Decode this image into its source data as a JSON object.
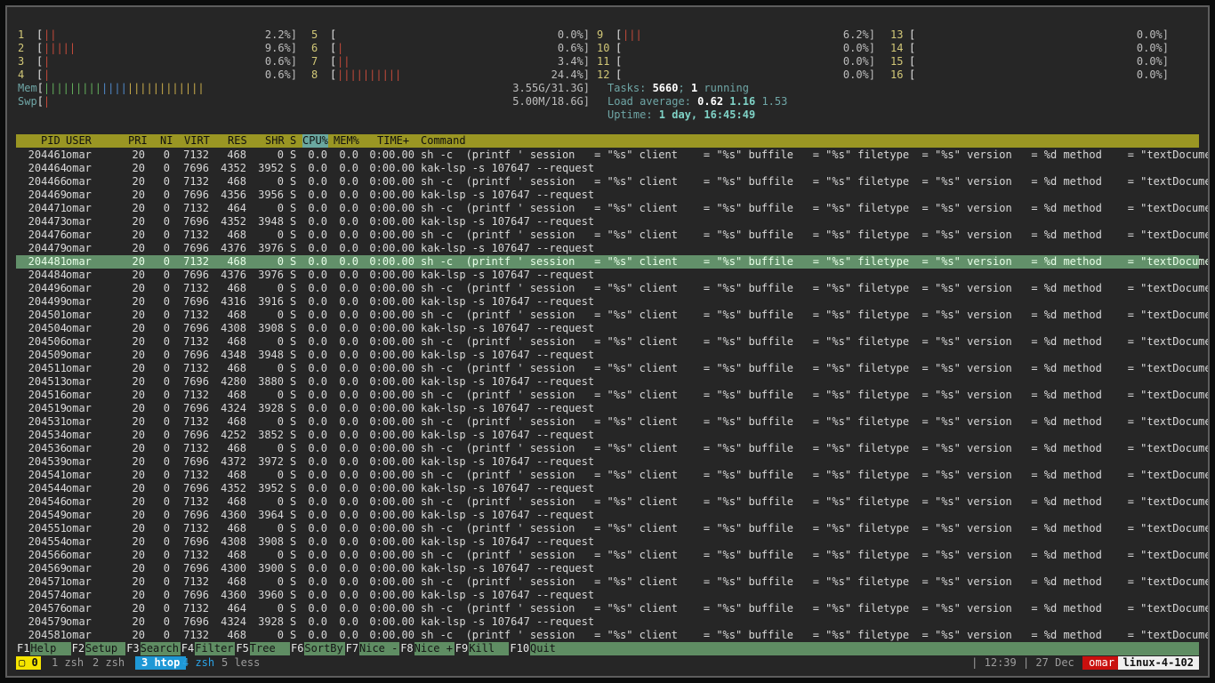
{
  "cpus": [
    {
      "id": "1",
      "pct": "2.2%]",
      "bars": [
        [
          "red",
          "||"
        ]
      ]
    },
    {
      "id": "2",
      "pct": "9.6%]",
      "bars": [
        [
          "red",
          "|||||"
        ]
      ]
    },
    {
      "id": "3",
      "pct": "0.6%]",
      "bars": [
        [
          "red",
          "|"
        ]
      ]
    },
    {
      "id": "4",
      "pct": "0.6%]",
      "bars": [
        [
          "red",
          "|"
        ]
      ]
    },
    {
      "id": "5",
      "pct": "0.0%]",
      "bars": []
    },
    {
      "id": "6",
      "pct": "0.6%]",
      "bars": [
        [
          "red",
          "|"
        ]
      ]
    },
    {
      "id": "7",
      "pct": "3.4%]",
      "bars": [
        [
          "red",
          "||"
        ]
      ]
    },
    {
      "id": "8",
      "pct": "24.4%]",
      "bars": [
        [
          "red",
          "||||||||||"
        ]
      ]
    },
    {
      "id": "9",
      "pct": "6.2%]",
      "bars": [
        [
          "red",
          "|||"
        ]
      ]
    },
    {
      "id": "10",
      "pct": "0.0%]",
      "bars": []
    },
    {
      "id": "11",
      "pct": "0.0%]",
      "bars": []
    },
    {
      "id": "12",
      "pct": "0.0%]",
      "bars": []
    },
    {
      "id": "13",
      "pct": "0.0%]",
      "bars": []
    },
    {
      "id": "14",
      "pct": "0.0%]",
      "bars": []
    },
    {
      "id": "15",
      "pct": "0.0%]",
      "bars": []
    },
    {
      "id": "16",
      "pct": "0.0%]",
      "bars": []
    }
  ],
  "mem": {
    "label": "Mem",
    "value": "3.55G/31.3G]",
    "bars": [
      [
        "grn",
        "|||||||||"
      ],
      [
        "blu",
        "||||"
      ],
      [
        "yel",
        "||||||||||||"
      ]
    ]
  },
  "swp": {
    "label": "Swp",
    "value": "5.00M/18.6G]",
    "bars": [
      [
        "red",
        "|"
      ]
    ]
  },
  "tasks": {
    "label": "Tasks: ",
    "count": "5660",
    "sep": "; ",
    "running": "1",
    "running_label": " running"
  },
  "load": {
    "label": "Load average: ",
    "l1": "0.62",
    "l5": "1.16",
    "l15": "1.53"
  },
  "uptime": {
    "label": "Uptime: ",
    "value": "1 day, 16:45:49"
  },
  "columns": {
    "pid": "PID",
    "user": "USER",
    "pri": "PRI",
    "ni": "NI",
    "virt": "VIRT",
    "res": "RES",
    "shr": "SHR",
    "s": "S",
    "cpu": "CPU%",
    "mem": "MEM%",
    "time": "TIME+",
    "command": "Command"
  },
  "cmd_sh": "sh -c  (printf ' session   = \"%s\" client    = \"%s\" buffile   = \"%s\" filetype  = \"%s\" version   = %d method    = \"textDocument",
  "cmd_kak": "kak-lsp -s 107647 --request",
  "processes": [
    {
      "pid": "204461",
      "user": "omar",
      "pri": "20",
      "ni": "0",
      "virt": "7132",
      "res": "468",
      "shr": "0",
      "s": "S",
      "cpu": "0.0",
      "mem": "0.0",
      "time": "0:00.00",
      "cmd": "sh"
    },
    {
      "pid": "204464",
      "user": "omar",
      "pri": "20",
      "ni": "0",
      "virt": "7696",
      "res": "4352",
      "shr": "3952",
      "s": "S",
      "cpu": "0.0",
      "mem": "0.0",
      "time": "0:00.00",
      "cmd": "kak"
    },
    {
      "pid": "204466",
      "user": "omar",
      "pri": "20",
      "ni": "0",
      "virt": "7132",
      "res": "468",
      "shr": "0",
      "s": "S",
      "cpu": "0.0",
      "mem": "0.0",
      "time": "0:00.00",
      "cmd": "sh"
    },
    {
      "pid": "204469",
      "user": "omar",
      "pri": "20",
      "ni": "0",
      "virt": "7696",
      "res": "4356",
      "shr": "3956",
      "s": "S",
      "cpu": "0.0",
      "mem": "0.0",
      "time": "0:00.00",
      "cmd": "kak"
    },
    {
      "pid": "204471",
      "user": "omar",
      "pri": "20",
      "ni": "0",
      "virt": "7132",
      "res": "464",
      "shr": "0",
      "s": "S",
      "cpu": "0.0",
      "mem": "0.0",
      "time": "0:00.00",
      "cmd": "sh"
    },
    {
      "pid": "204473",
      "user": "omar",
      "pri": "20",
      "ni": "0",
      "virt": "7696",
      "res": "4352",
      "shr": "3948",
      "s": "S",
      "cpu": "0.0",
      "mem": "0.0",
      "time": "0:00.00",
      "cmd": "kak"
    },
    {
      "pid": "204476",
      "user": "omar",
      "pri": "20",
      "ni": "0",
      "virt": "7132",
      "res": "468",
      "shr": "0",
      "s": "S",
      "cpu": "0.0",
      "mem": "0.0",
      "time": "0:00.00",
      "cmd": "sh"
    },
    {
      "pid": "204479",
      "user": "omar",
      "pri": "20",
      "ni": "0",
      "virt": "7696",
      "res": "4376",
      "shr": "3976",
      "s": "S",
      "cpu": "0.0",
      "mem": "0.0",
      "time": "0:00.00",
      "cmd": "kak"
    },
    {
      "pid": "204481",
      "user": "omar",
      "pri": "20",
      "ni": "0",
      "virt": "7132",
      "res": "468",
      "shr": "0",
      "s": "S",
      "cpu": "0.0",
      "mem": "0.0",
      "time": "0:00.00",
      "cmd": "sh",
      "selected": true
    },
    {
      "pid": "204484",
      "user": "omar",
      "pri": "20",
      "ni": "0",
      "virt": "7696",
      "res": "4376",
      "shr": "3976",
      "s": "S",
      "cpu": "0.0",
      "mem": "0.0",
      "time": "0:00.00",
      "cmd": "kak"
    },
    {
      "pid": "204496",
      "user": "omar",
      "pri": "20",
      "ni": "0",
      "virt": "7132",
      "res": "468",
      "shr": "0",
      "s": "S",
      "cpu": "0.0",
      "mem": "0.0",
      "time": "0:00.00",
      "cmd": "sh"
    },
    {
      "pid": "204499",
      "user": "omar",
      "pri": "20",
      "ni": "0",
      "virt": "7696",
      "res": "4316",
      "shr": "3916",
      "s": "S",
      "cpu": "0.0",
      "mem": "0.0",
      "time": "0:00.00",
      "cmd": "kak"
    },
    {
      "pid": "204501",
      "user": "omar",
      "pri": "20",
      "ni": "0",
      "virt": "7132",
      "res": "468",
      "shr": "0",
      "s": "S",
      "cpu": "0.0",
      "mem": "0.0",
      "time": "0:00.00",
      "cmd": "sh"
    },
    {
      "pid": "204504",
      "user": "omar",
      "pri": "20",
      "ni": "0",
      "virt": "7696",
      "res": "4308",
      "shr": "3908",
      "s": "S",
      "cpu": "0.0",
      "mem": "0.0",
      "time": "0:00.00",
      "cmd": "kak"
    },
    {
      "pid": "204506",
      "user": "omar",
      "pri": "20",
      "ni": "0",
      "virt": "7132",
      "res": "468",
      "shr": "0",
      "s": "S",
      "cpu": "0.0",
      "mem": "0.0",
      "time": "0:00.00",
      "cmd": "sh"
    },
    {
      "pid": "204509",
      "user": "omar",
      "pri": "20",
      "ni": "0",
      "virt": "7696",
      "res": "4348",
      "shr": "3948",
      "s": "S",
      "cpu": "0.0",
      "mem": "0.0",
      "time": "0:00.00",
      "cmd": "kak"
    },
    {
      "pid": "204511",
      "user": "omar",
      "pri": "20",
      "ni": "0",
      "virt": "7132",
      "res": "468",
      "shr": "0",
      "s": "S",
      "cpu": "0.0",
      "mem": "0.0",
      "time": "0:00.00",
      "cmd": "sh"
    },
    {
      "pid": "204513",
      "user": "omar",
      "pri": "20",
      "ni": "0",
      "virt": "7696",
      "res": "4280",
      "shr": "3880",
      "s": "S",
      "cpu": "0.0",
      "mem": "0.0",
      "time": "0:00.00",
      "cmd": "kak"
    },
    {
      "pid": "204516",
      "user": "omar",
      "pri": "20",
      "ni": "0",
      "virt": "7132",
      "res": "468",
      "shr": "0",
      "s": "S",
      "cpu": "0.0",
      "mem": "0.0",
      "time": "0:00.00",
      "cmd": "sh"
    },
    {
      "pid": "204519",
      "user": "omar",
      "pri": "20",
      "ni": "0",
      "virt": "7696",
      "res": "4324",
      "shr": "3928",
      "s": "S",
      "cpu": "0.0",
      "mem": "0.0",
      "time": "0:00.00",
      "cmd": "kak"
    },
    {
      "pid": "204531",
      "user": "omar",
      "pri": "20",
      "ni": "0",
      "virt": "7132",
      "res": "468",
      "shr": "0",
      "s": "S",
      "cpu": "0.0",
      "mem": "0.0",
      "time": "0:00.00",
      "cmd": "sh"
    },
    {
      "pid": "204534",
      "user": "omar",
      "pri": "20",
      "ni": "0",
      "virt": "7696",
      "res": "4252",
      "shr": "3852",
      "s": "S",
      "cpu": "0.0",
      "mem": "0.0",
      "time": "0:00.00",
      "cmd": "kak"
    },
    {
      "pid": "204536",
      "user": "omar",
      "pri": "20",
      "ni": "0",
      "virt": "7132",
      "res": "468",
      "shr": "0",
      "s": "S",
      "cpu": "0.0",
      "mem": "0.0",
      "time": "0:00.00",
      "cmd": "sh"
    },
    {
      "pid": "204539",
      "user": "omar",
      "pri": "20",
      "ni": "0",
      "virt": "7696",
      "res": "4372",
      "shr": "3972",
      "s": "S",
      "cpu": "0.0",
      "mem": "0.0",
      "time": "0:00.00",
      "cmd": "kak"
    },
    {
      "pid": "204541",
      "user": "omar",
      "pri": "20",
      "ni": "0",
      "virt": "7132",
      "res": "468",
      "shr": "0",
      "s": "S",
      "cpu": "0.0",
      "mem": "0.0",
      "time": "0:00.00",
      "cmd": "sh"
    },
    {
      "pid": "204544",
      "user": "omar",
      "pri": "20",
      "ni": "0",
      "virt": "7696",
      "res": "4352",
      "shr": "3952",
      "s": "S",
      "cpu": "0.0",
      "mem": "0.0",
      "time": "0:00.00",
      "cmd": "kak"
    },
    {
      "pid": "204546",
      "user": "omar",
      "pri": "20",
      "ni": "0",
      "virt": "7132",
      "res": "468",
      "shr": "0",
      "s": "S",
      "cpu": "0.0",
      "mem": "0.0",
      "time": "0:00.00",
      "cmd": "sh"
    },
    {
      "pid": "204549",
      "user": "omar",
      "pri": "20",
      "ni": "0",
      "virt": "7696",
      "res": "4360",
      "shr": "3964",
      "s": "S",
      "cpu": "0.0",
      "mem": "0.0",
      "time": "0:00.00",
      "cmd": "kak"
    },
    {
      "pid": "204551",
      "user": "omar",
      "pri": "20",
      "ni": "0",
      "virt": "7132",
      "res": "468",
      "shr": "0",
      "s": "S",
      "cpu": "0.0",
      "mem": "0.0",
      "time": "0:00.00",
      "cmd": "sh"
    },
    {
      "pid": "204554",
      "user": "omar",
      "pri": "20",
      "ni": "0",
      "virt": "7696",
      "res": "4308",
      "shr": "3908",
      "s": "S",
      "cpu": "0.0",
      "mem": "0.0",
      "time": "0:00.00",
      "cmd": "kak"
    },
    {
      "pid": "204566",
      "user": "omar",
      "pri": "20",
      "ni": "0",
      "virt": "7132",
      "res": "468",
      "shr": "0",
      "s": "S",
      "cpu": "0.0",
      "mem": "0.0",
      "time": "0:00.00",
      "cmd": "sh"
    },
    {
      "pid": "204569",
      "user": "omar",
      "pri": "20",
      "ni": "0",
      "virt": "7696",
      "res": "4300",
      "shr": "3900",
      "s": "S",
      "cpu": "0.0",
      "mem": "0.0",
      "time": "0:00.00",
      "cmd": "kak"
    },
    {
      "pid": "204571",
      "user": "omar",
      "pri": "20",
      "ni": "0",
      "virt": "7132",
      "res": "468",
      "shr": "0",
      "s": "S",
      "cpu": "0.0",
      "mem": "0.0",
      "time": "0:00.00",
      "cmd": "sh"
    },
    {
      "pid": "204574",
      "user": "omar",
      "pri": "20",
      "ni": "0",
      "virt": "7696",
      "res": "4360",
      "shr": "3960",
      "s": "S",
      "cpu": "0.0",
      "mem": "0.0",
      "time": "0:00.00",
      "cmd": "kak"
    },
    {
      "pid": "204576",
      "user": "omar",
      "pri": "20",
      "ni": "0",
      "virt": "7132",
      "res": "464",
      "shr": "0",
      "s": "S",
      "cpu": "0.0",
      "mem": "0.0",
      "time": "0:00.00",
      "cmd": "sh"
    },
    {
      "pid": "204579",
      "user": "omar",
      "pri": "20",
      "ni": "0",
      "virt": "7696",
      "res": "4324",
      "shr": "3928",
      "s": "S",
      "cpu": "0.0",
      "mem": "0.0",
      "time": "0:00.00",
      "cmd": "kak"
    },
    {
      "pid": "204581",
      "user": "omar",
      "pri": "20",
      "ni": "0",
      "virt": "7132",
      "res": "468",
      "shr": "0",
      "s": "S",
      "cpu": "0.0",
      "mem": "0.0",
      "time": "0:00.00",
      "cmd": "sh"
    }
  ],
  "fkeys": [
    {
      "key": "F1",
      "label": "Help  "
    },
    {
      "key": "F2",
      "label": "Setup "
    },
    {
      "key": "F3",
      "label": "Search"
    },
    {
      "key": "F4",
      "label": "Filter"
    },
    {
      "key": "F5",
      "label": "Tree  "
    },
    {
      "key": "F6",
      "label": "SortBy"
    },
    {
      "key": "F7",
      "label": "Nice -"
    },
    {
      "key": "F8",
      "label": "Nice +"
    },
    {
      "key": "F9",
      "label": "Kill  "
    },
    {
      "key": "F10",
      "label": "Quit"
    }
  ],
  "tmux": {
    "session_icon": "▢",
    "session": "0",
    "windows": [
      {
        "label": "1 zsh",
        "active": false
      },
      {
        "label": "2 zsh",
        "active": false
      },
      {
        "label": "3 htop",
        "active": true
      },
      {
        "label": "4 zsh",
        "active": false,
        "last": true
      },
      {
        "label": "5 less",
        "active": false
      }
    ],
    "time": "| 12:39 | 27 Dec ",
    "user": "omar",
    "host": "linux-4-102",
    "colors": {
      "session_bg": "#f5e400",
      "active_bg": "#1e98d6",
      "user_bg": "#c9100e",
      "host_bg": "#efefef"
    }
  }
}
